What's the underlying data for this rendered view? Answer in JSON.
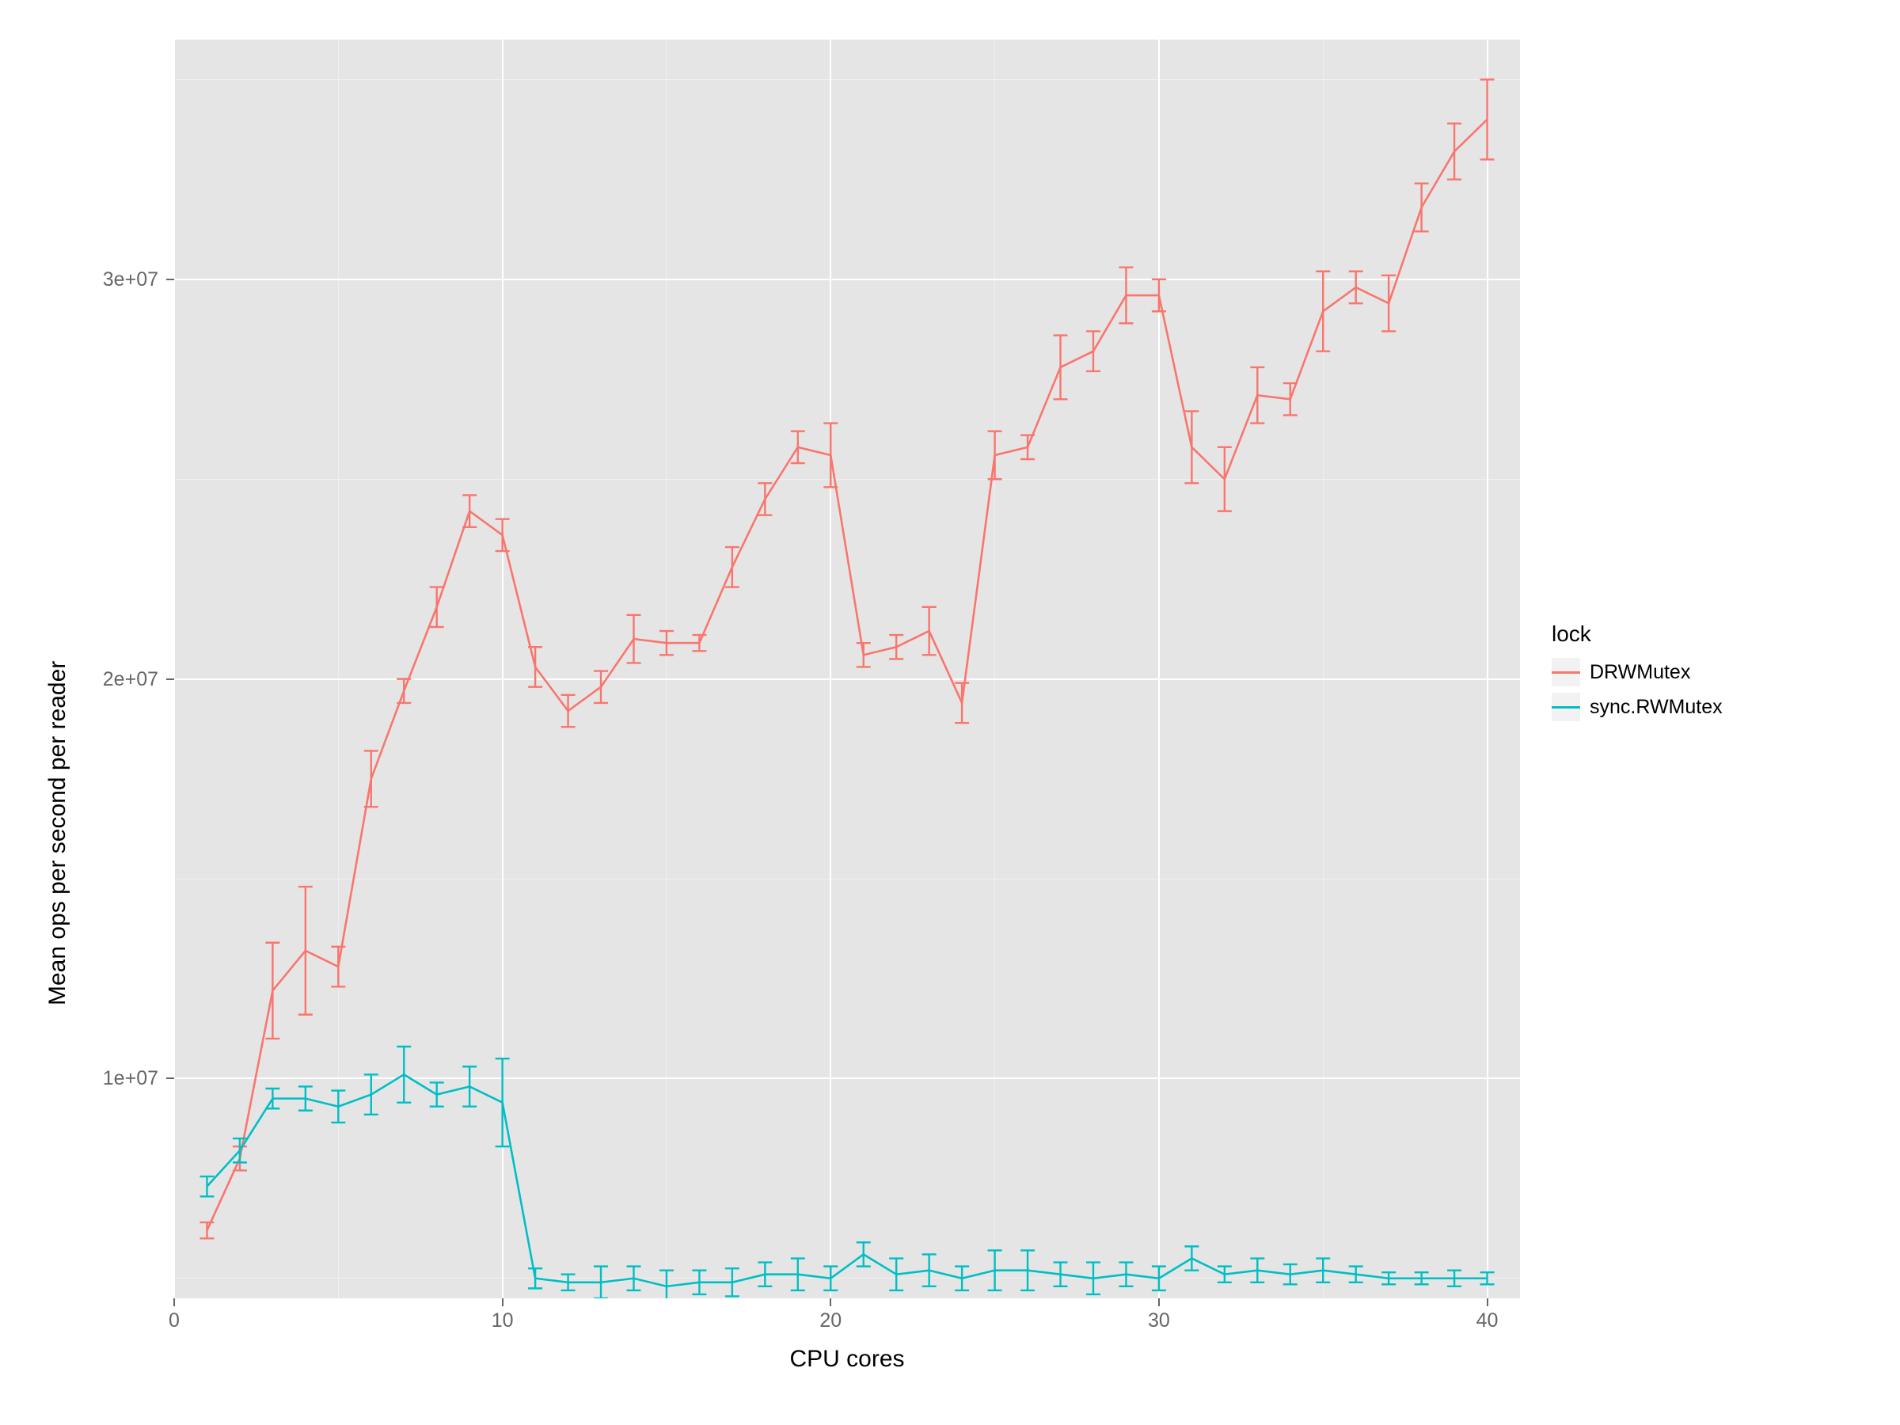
{
  "chart_data": {
    "type": "line",
    "xlabel": "CPU cores",
    "ylabel": "Mean ops per second per reader",
    "xlim": [
      0,
      41
    ],
    "ylim": [
      4500000,
      36000000
    ],
    "x_ticks": [
      0,
      10,
      20,
      30,
      40
    ],
    "x_tick_labels": [
      "0",
      "10",
      "20",
      "30",
      "40"
    ],
    "y_ticks": [
      10000000,
      20000000,
      30000000
    ],
    "y_tick_labels": [
      "1e+07",
      "2e+07",
      "3e+07"
    ],
    "x_minor_ticks": [
      5,
      15,
      25,
      35
    ],
    "y_minor_ticks": [
      5000000,
      15000000,
      25000000,
      35000000
    ],
    "legend_title": "lock",
    "legend_position": "right",
    "series": [
      {
        "name": "DRWMutex",
        "color": "#f8766d",
        "x": [
          1,
          2,
          3,
          4,
          5,
          6,
          7,
          8,
          9,
          10,
          11,
          12,
          13,
          14,
          15,
          16,
          17,
          18,
          19,
          20,
          21,
          22,
          23,
          24,
          25,
          26,
          27,
          28,
          29,
          30,
          31,
          32,
          33,
          34,
          35,
          36,
          37,
          38,
          39,
          40
        ],
        "y": [
          6200000,
          8000000,
          12200000,
          13200000,
          12800000,
          17500000,
          19700000,
          21800000,
          24200000,
          23600000,
          20300000,
          19200000,
          19800000,
          21000000,
          20900000,
          20900000,
          22800000,
          24500000,
          25800000,
          25600000,
          20600000,
          20800000,
          21200000,
          19400000,
          25600000,
          25800000,
          27800000,
          28200000,
          29600000,
          29600000,
          25800000,
          25000000,
          27100000,
          27000000,
          29200000,
          29800000,
          29400000,
          31800000,
          33200000,
          34000000
        ],
        "err": [
          200000,
          300000,
          1200000,
          1600000,
          500000,
          700000,
          300000,
          500000,
          400000,
          400000,
          500000,
          400000,
          400000,
          600000,
          300000,
          200000,
          500000,
          400000,
          400000,
          800000,
          300000,
          300000,
          600000,
          500000,
          600000,
          300000,
          800000,
          500000,
          700000,
          400000,
          900000,
          800000,
          700000,
          400000,
          1000000,
          400000,
          700000,
          600000,
          700000,
          1000000
        ]
      },
      {
        "name": "sync.RWMutex",
        "color": "#00bfc4",
        "x": [
          1,
          2,
          3,
          4,
          5,
          6,
          7,
          8,
          9,
          10,
          11,
          12,
          13,
          14,
          15,
          16,
          17,
          18,
          19,
          20,
          21,
          22,
          23,
          24,
          25,
          26,
          27,
          28,
          29,
          30,
          31,
          32,
          33,
          34,
          35,
          36,
          37,
          38,
          39,
          40
        ],
        "y": [
          7300000,
          8200000,
          9500000,
          9500000,
          9300000,
          9600000,
          10100000,
          9600000,
          9800000,
          9400000,
          5000000,
          4900000,
          4900000,
          5000000,
          4800000,
          4900000,
          4900000,
          5100000,
          5100000,
          5000000,
          5600000,
          5100000,
          5200000,
          5000000,
          5200000,
          5200000,
          5100000,
          5000000,
          5100000,
          5000000,
          5500000,
          5100000,
          5200000,
          5100000,
          5200000,
          5100000,
          5000000,
          5000000,
          5000000,
          5000000
        ],
        "err": [
          250000,
          300000,
          250000,
          300000,
          400000,
          500000,
          700000,
          300000,
          500000,
          1100000,
          250000,
          200000,
          400000,
          300000,
          400000,
          300000,
          350000,
          300000,
          400000,
          300000,
          300000,
          400000,
          400000,
          300000,
          500000,
          500000,
          300000,
          400000,
          300000,
          300000,
          300000,
          200000,
          300000,
          250000,
          300000,
          200000,
          150000,
          150000,
          200000,
          150000
        ]
      }
    ]
  }
}
